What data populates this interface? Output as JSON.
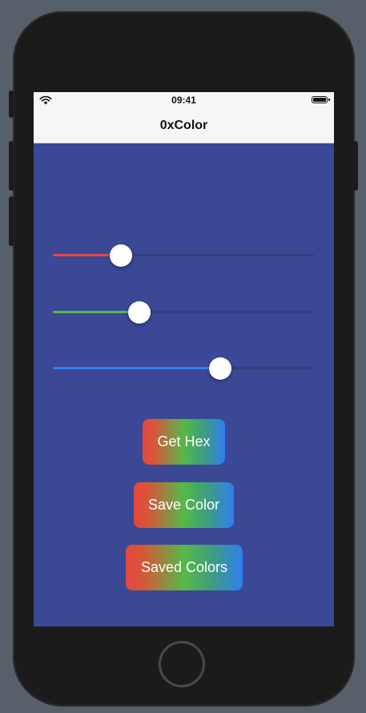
{
  "status_bar": {
    "time": "09:41",
    "icons": [
      "wifi-icon",
      "battery-icon"
    ]
  },
  "nav_bar": {
    "title": "0xColor"
  },
  "colors": {
    "screen_background": "#3a4896",
    "red_track": "#e4473a",
    "green_track": "#55b948",
    "blue_track": "#2f7ef2"
  },
  "sliders": [
    {
      "name": "red",
      "value_fraction": 0.26
    },
    {
      "name": "green",
      "value_fraction": 0.33
    },
    {
      "name": "blue",
      "value_fraction": 0.64
    }
  ],
  "buttons": {
    "get_hex": "Get Hex",
    "save_color": "Save Color",
    "saved_colors": "Saved Colors"
  }
}
